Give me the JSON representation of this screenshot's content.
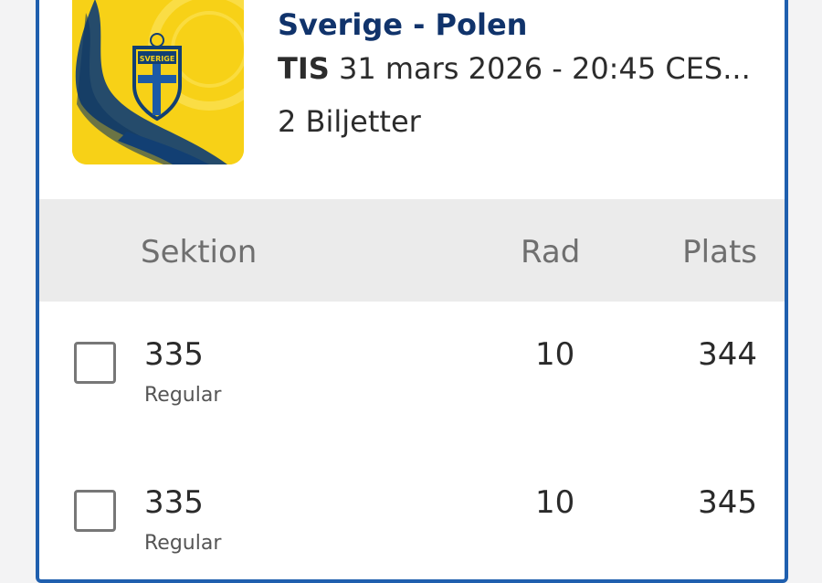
{
  "event": {
    "title": "Sverige - Polen",
    "day": "TIS",
    "date_rest": " 31 mars 2026 - 20:45 CES...",
    "tickets": "2 Biljetter",
    "logo_text": "SVERIGE"
  },
  "table": {
    "headers": {
      "section": "Sektion",
      "row": "Rad",
      "seat": "Plats"
    },
    "rows": [
      {
        "section": "335",
        "type": "Regular",
        "row": "10",
        "seat": "344",
        "checked": false
      },
      {
        "section": "335",
        "type": "Regular",
        "row": "10",
        "seat": "345",
        "checked": false
      }
    ]
  },
  "colors": {
    "accent_border": "#1f5fae",
    "title_navy": "#10336b",
    "brand_yellow": "#f7d117"
  }
}
